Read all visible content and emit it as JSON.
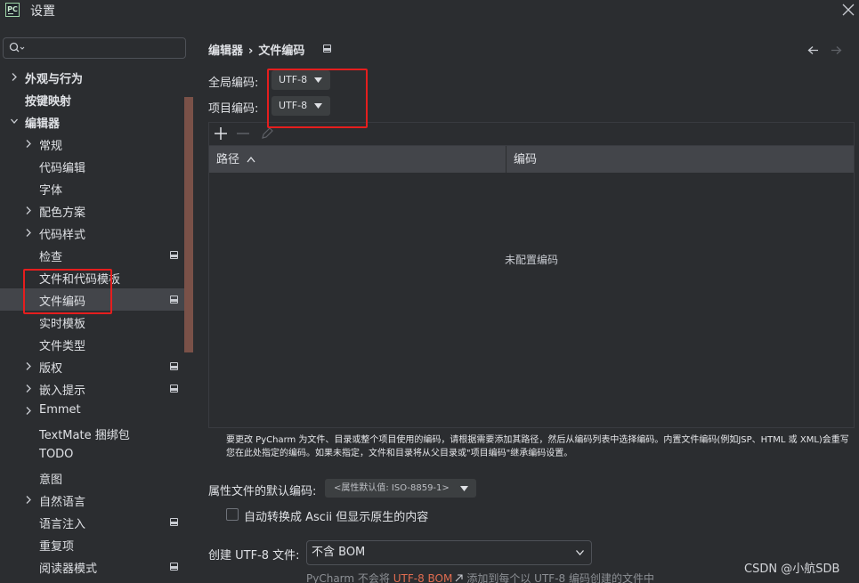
{
  "window": {
    "logo_text": "PC",
    "title": "设置"
  },
  "search": {
    "value": "",
    "placeholder": ""
  },
  "tree": [
    {
      "label": "外观与行为",
      "level": 0,
      "expandable": true,
      "expanded": false,
      "bold": true,
      "scope": false,
      "selected": false
    },
    {
      "label": "按键映射",
      "level": 0,
      "expandable": false,
      "expanded": false,
      "bold": true,
      "scope": false,
      "selected": false
    },
    {
      "label": "编辑器",
      "level": 0,
      "expandable": true,
      "expanded": true,
      "bold": true,
      "scope": false,
      "selected": false
    },
    {
      "label": "常规",
      "level": 1,
      "expandable": true,
      "expanded": false,
      "bold": false,
      "scope": false,
      "selected": false
    },
    {
      "label": "代码编辑",
      "level": 1,
      "expandable": false,
      "expanded": false,
      "bold": false,
      "scope": false,
      "selected": false
    },
    {
      "label": "字体",
      "level": 1,
      "expandable": false,
      "expanded": false,
      "bold": false,
      "scope": false,
      "selected": false
    },
    {
      "label": "配色方案",
      "level": 1,
      "expandable": true,
      "expanded": false,
      "bold": false,
      "scope": false,
      "selected": false
    },
    {
      "label": "代码样式",
      "level": 1,
      "expandable": true,
      "expanded": false,
      "bold": false,
      "scope": false,
      "selected": false
    },
    {
      "label": "检查",
      "level": 1,
      "expandable": false,
      "expanded": false,
      "bold": false,
      "scope": true,
      "selected": false
    },
    {
      "label": "文件和代码模板",
      "level": 1,
      "expandable": false,
      "expanded": false,
      "bold": false,
      "scope": false,
      "selected": false
    },
    {
      "label": "文件编码",
      "level": 1,
      "expandable": false,
      "expanded": false,
      "bold": false,
      "scope": true,
      "selected": true
    },
    {
      "label": "实时模板",
      "level": 1,
      "expandable": false,
      "expanded": false,
      "bold": false,
      "scope": false,
      "selected": false
    },
    {
      "label": "文件类型",
      "level": 1,
      "expandable": false,
      "expanded": false,
      "bold": false,
      "scope": false,
      "selected": false
    },
    {
      "label": "版权",
      "level": 1,
      "expandable": true,
      "expanded": false,
      "bold": false,
      "scope": true,
      "selected": false
    },
    {
      "label": "嵌入提示",
      "level": 1,
      "expandable": true,
      "expanded": false,
      "bold": false,
      "scope": true,
      "selected": false
    },
    {
      "label": "Emmet",
      "level": 1,
      "expandable": true,
      "expanded": false,
      "bold": false,
      "scope": false,
      "selected": false
    },
    {
      "label": "TextMate 捆绑包",
      "level": 1,
      "expandable": false,
      "expanded": false,
      "bold": false,
      "scope": false,
      "selected": false
    },
    {
      "label": "TODO",
      "level": 1,
      "expandable": false,
      "expanded": false,
      "bold": false,
      "scope": false,
      "selected": false
    },
    {
      "label": "意图",
      "level": 1,
      "expandable": false,
      "expanded": false,
      "bold": false,
      "scope": false,
      "selected": false
    },
    {
      "label": "自然语言",
      "level": 1,
      "expandable": true,
      "expanded": false,
      "bold": false,
      "scope": false,
      "selected": false
    },
    {
      "label": "语言注入",
      "level": 1,
      "expandable": false,
      "expanded": false,
      "bold": false,
      "scope": true,
      "selected": false
    },
    {
      "label": "重复项",
      "level": 1,
      "expandable": false,
      "expanded": false,
      "bold": false,
      "scope": false,
      "selected": false
    },
    {
      "label": "阅读器模式",
      "level": 1,
      "expandable": false,
      "expanded": false,
      "bold": false,
      "scope": true,
      "selected": false
    }
  ],
  "breadcrumb": {
    "parent": "编辑器",
    "separator": "›",
    "current": "文件编码"
  },
  "encoding": {
    "global_label": "全局编码:",
    "global_value": "UTF-8",
    "project_label": "项目编码:",
    "project_value": "UTF-8"
  },
  "table": {
    "columns": [
      "路径",
      "编码"
    ],
    "empty_text": "未配置编码"
  },
  "help_text": "要更改 PyCharm 为文件、目录或整个项目使用的编码，请根据需要添加其路径，然后从编码列表中选择编码。内置文件编码(例如JSP、HTML 或 XML)会重写您在此处指定的编码。如果未指定，文件和目录将从父目录或\"项目编码\"继承编码设置。",
  "properties": {
    "label": "属性文件的默认编码:",
    "value": "<属性默认值: ISO-8859-1>",
    "ascii_checkbox_label": "自动转换成 Ascii 但显示原生的内容",
    "ascii_checked": false
  },
  "bom": {
    "label": "创建 UTF-8 文件:",
    "value": "不含 BOM",
    "note_before": "PyCharm 不会将",
    "note_link": "UTF-8 BOM",
    "note_after": "添加到每个以 UTF-8 编码创建的文件中"
  },
  "watermark": "CSDN @小航SDB",
  "colors": {
    "background": "#2b2d30",
    "selection": "#43454a",
    "annotation_red": "#e51e1e",
    "link": "#e06c50",
    "scrollbar": "#7a5148"
  }
}
